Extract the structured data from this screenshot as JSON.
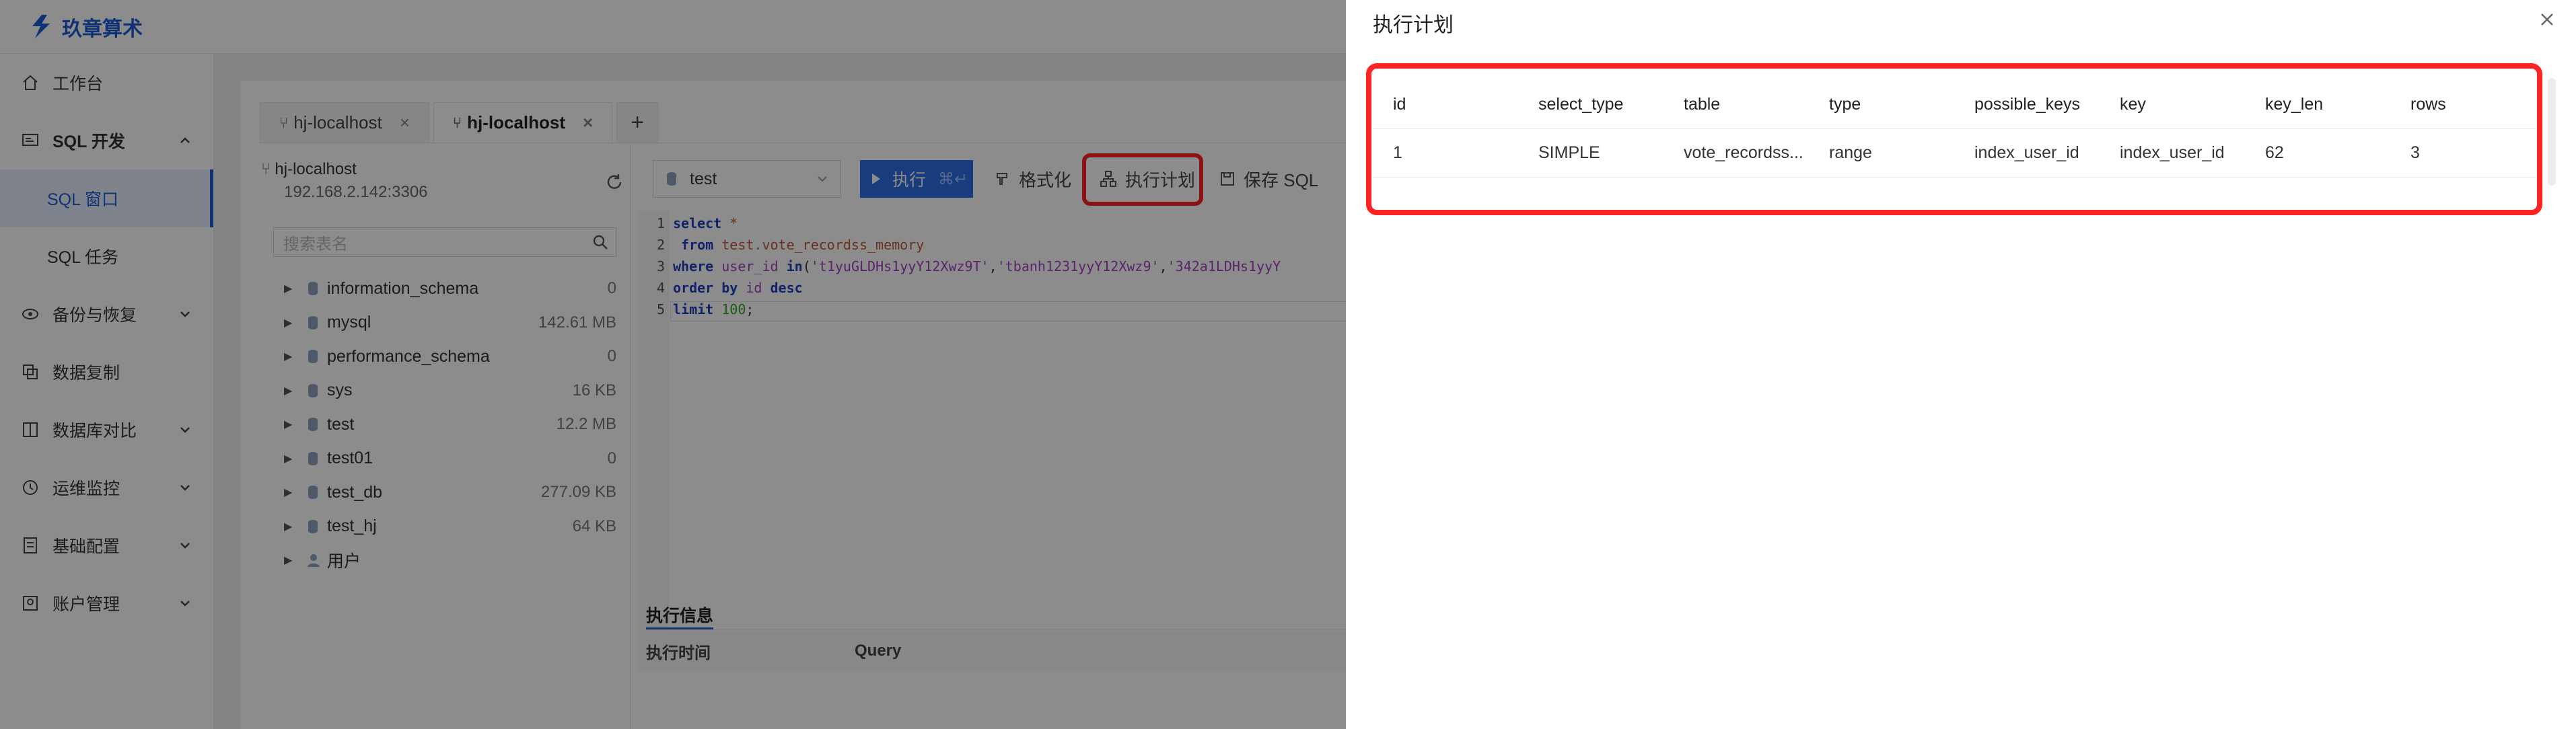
{
  "app": {
    "name": "玖章算术"
  },
  "sidebar": {
    "items": [
      {
        "label": "工作台",
        "icon": "home-icon",
        "expandable": false
      },
      {
        "label": "SQL 开发",
        "icon": "sql-dev-icon",
        "expandable": true,
        "expanded": true,
        "children": [
          {
            "label": "SQL 窗口",
            "active": true
          },
          {
            "label": "SQL 任务",
            "active": false
          }
        ]
      },
      {
        "label": "备份与恢复",
        "icon": "backup-icon",
        "expandable": true
      },
      {
        "label": "数据复制",
        "icon": "copy-icon",
        "expandable": false
      },
      {
        "label": "数据库对比",
        "icon": "compare-icon",
        "expandable": true
      },
      {
        "label": "运维监控",
        "icon": "monitor-icon",
        "expandable": true
      },
      {
        "label": "基础配置",
        "icon": "config-icon",
        "expandable": true
      },
      {
        "label": "账户管理",
        "icon": "account-icon",
        "expandable": true
      }
    ]
  },
  "tabs": [
    {
      "label": "hj-localhost",
      "active": false
    },
    {
      "label": "hj-localhost",
      "active": true
    }
  ],
  "connection": {
    "name": "hj-localhost",
    "host": "192.168.2.142:3306"
  },
  "search": {
    "placeholder": "搜索表名"
  },
  "databases": [
    {
      "name": "information_schema",
      "size": "0"
    },
    {
      "name": "mysql",
      "size": "142.61 MB"
    },
    {
      "name": "performance_schema",
      "size": "0"
    },
    {
      "name": "sys",
      "size": "16 KB"
    },
    {
      "name": "test",
      "size": "12.2 MB"
    },
    {
      "name": "test01",
      "size": "0"
    },
    {
      "name": "test_db",
      "size": "277.09 KB"
    },
    {
      "name": "test_hj",
      "size": "64 KB"
    },
    {
      "name": "用户",
      "size": ""
    }
  ],
  "toolbar": {
    "db": "test",
    "run": "执行",
    "run_shortcut": "⌘↵",
    "format": "格式化",
    "explain": "执行计划",
    "save": "保存 SQL"
  },
  "editor": {
    "line_numbers": [
      "1",
      "2",
      "3",
      "4",
      "5"
    ]
  },
  "info": {
    "tab": "执行信息",
    "col_time": "执行时间",
    "col_query": "Query"
  },
  "drawer": {
    "title": "执行计划",
    "columns": [
      "id",
      "select_type",
      "table",
      "type",
      "possible_keys",
      "key",
      "key_len",
      "rows"
    ],
    "rows": [
      [
        "1",
        "SIMPLE",
        "vote_recordss...",
        "range",
        "index_user_id",
        "index_user_id",
        "62",
        "3"
      ]
    ]
  },
  "colors": {
    "accent": "#1d5bd6",
    "highlight": "#ff2424",
    "run_button": "#2f6ee8"
  }
}
